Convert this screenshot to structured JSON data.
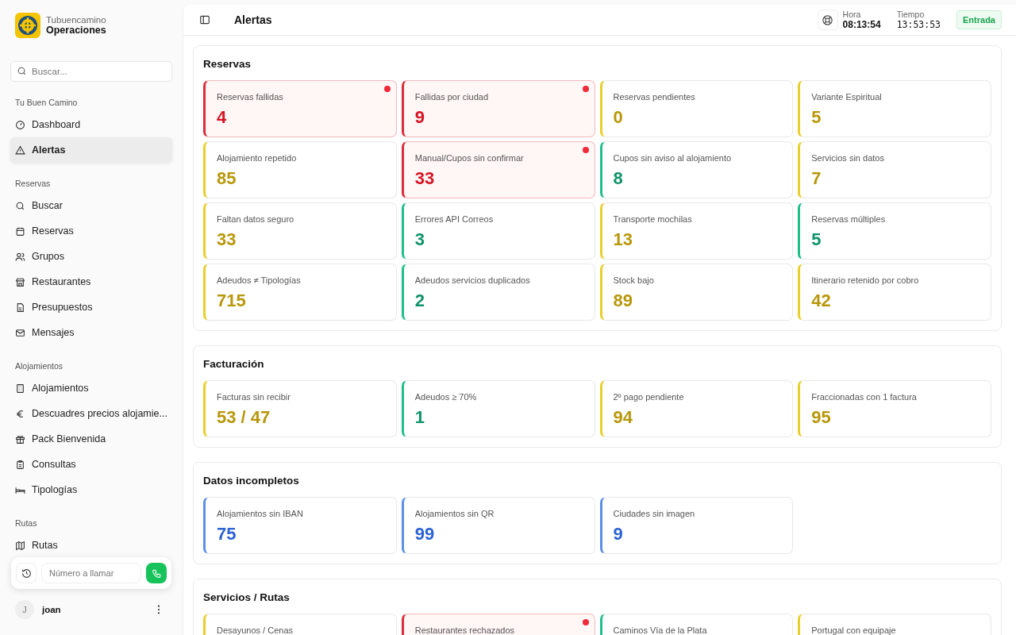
{
  "brand": {
    "name": "Tubuencamino",
    "subtitle": "Operaciones"
  },
  "sidebar": {
    "search": {
      "placeholder": "Buscar..."
    },
    "groups": [
      {
        "title": "Tu Buen Camino",
        "items": [
          {
            "label": "Dashboard",
            "selected": false
          },
          {
            "label": "Alertas",
            "selected": true
          }
        ]
      },
      {
        "title": "Reservas",
        "items": [
          {
            "label": "Buscar",
            "selected": false
          },
          {
            "label": "Reservas",
            "selected": false
          },
          {
            "label": "Grupos",
            "selected": false
          },
          {
            "label": "Restaurantes",
            "selected": false
          },
          {
            "label": "Presupuestos",
            "selected": false
          },
          {
            "label": "Mensajes",
            "selected": false
          }
        ]
      },
      {
        "title": "Alojamientos",
        "items": [
          {
            "label": "Alojamientos",
            "selected": false
          },
          {
            "label": "Descuadres precios alojamie...",
            "selected": false
          },
          {
            "label": "Pack Bienvenida",
            "selected": false
          },
          {
            "label": "Consultas",
            "selected": false
          },
          {
            "label": "Tipologías",
            "selected": false
          }
        ]
      },
      {
        "title": "Rutas",
        "items": [
          {
            "label": "Rutas",
            "selected": false
          }
        ]
      }
    ],
    "call": {
      "placeholder": "Número a llamar"
    },
    "user": {
      "initial": "J",
      "name": "joan"
    }
  },
  "header": {
    "title": "Alertas",
    "hora_label": "Hora",
    "hora": "08:13:54",
    "tiempo_label": "Tiempo",
    "tiempo": "13:53:53",
    "badge": "Entrada"
  },
  "sections": [
    {
      "title": "Reservas",
      "cards": [
        {
          "label": "Reservas fallidas",
          "value": "4",
          "kind": "critical"
        },
        {
          "label": "Fallidas por ciudad",
          "value": "9",
          "kind": "critical"
        },
        {
          "label": "Reservas pendientes",
          "value": "0",
          "kind": "warning"
        },
        {
          "label": "Variante Espiritual",
          "value": "5",
          "kind": "warning"
        },
        {
          "label": "Alojamiento repetido",
          "value": "85",
          "kind": "warning"
        },
        {
          "label": "Manual/Cupos sin confirmar",
          "value": "33",
          "kind": "critical"
        },
        {
          "label": "Cupos sin aviso al alojamiento",
          "value": "8",
          "kind": "ok"
        },
        {
          "label": "Servicios sin datos",
          "value": "7",
          "kind": "warning"
        },
        {
          "label": "Faltan datos seguro",
          "value": "33",
          "kind": "warning"
        },
        {
          "label": "Errores API Correos",
          "value": "3",
          "kind": "ok"
        },
        {
          "label": "Transporte mochilas",
          "value": "13",
          "kind": "warning"
        },
        {
          "label": "Reservas múltiples",
          "value": "5",
          "kind": "ok"
        },
        {
          "label": "Adeudos ≠ Tipologías",
          "value": "715",
          "kind": "warning"
        },
        {
          "label": "Adeudos servicios duplicados",
          "value": "2",
          "kind": "ok"
        },
        {
          "label": "Stock bajo",
          "value": "89",
          "kind": "warning"
        },
        {
          "label": "Itinerario retenido por cobro",
          "value": "42",
          "kind": "warning"
        }
      ]
    },
    {
      "title": "Facturación",
      "cards": [
        {
          "label": "Facturas sin recibir",
          "value": "53 / 47",
          "kind": "warning"
        },
        {
          "label": "Adeudos ≥ 70%",
          "value": "1",
          "kind": "ok"
        },
        {
          "label": "2º pago pendiente",
          "value": "94",
          "kind": "warning"
        },
        {
          "label": "Fraccionadas con 1 factura",
          "value": "95",
          "kind": "warning"
        }
      ]
    },
    {
      "title": "Datos incompletos",
      "cards": [
        {
          "label": "Alojamientos sin IBAN",
          "value": "75",
          "kind": "info"
        },
        {
          "label": "Alojamientos sin QR",
          "value": "99",
          "kind": "info"
        },
        {
          "label": "Ciudades sin imagen",
          "value": "9",
          "kind": "info"
        }
      ]
    },
    {
      "title": "Servicios / Rutas",
      "cards": [
        {
          "label": "Desayunos / Cenas",
          "kind": "warning"
        },
        {
          "label": "Restaurantes rechazados",
          "kind": "critical"
        },
        {
          "label": "Caminos Vía de la Plata",
          "kind": "ok"
        },
        {
          "label": "Portugal con equipaje",
          "kind": "warning"
        }
      ]
    }
  ]
}
